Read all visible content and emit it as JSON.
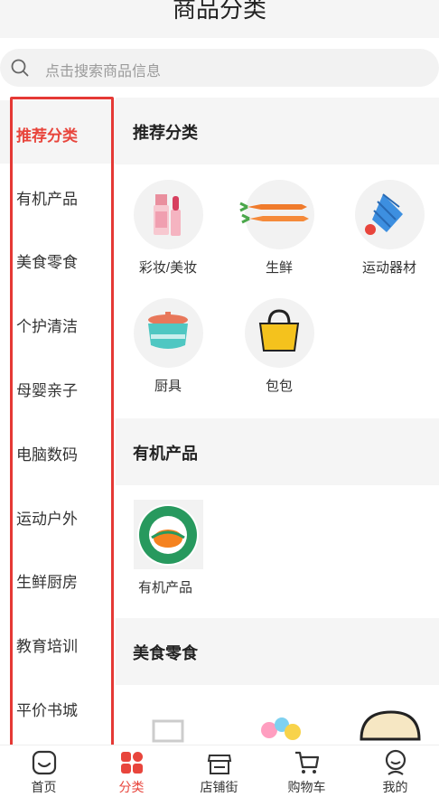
{
  "header": {
    "title": "商品分类"
  },
  "search": {
    "placeholder": "点击搜索商品信息"
  },
  "sidebar": {
    "items": [
      {
        "label": "推荐分类",
        "active": true
      },
      {
        "label": "有机产品"
      },
      {
        "label": "美食零食"
      },
      {
        "label": "个护清洁"
      },
      {
        "label": "母婴亲子"
      },
      {
        "label": "电脑数码"
      },
      {
        "label": "运动户外"
      },
      {
        "label": "生鲜厨房"
      },
      {
        "label": "教育培训"
      },
      {
        "label": "平价书城"
      }
    ]
  },
  "sections": [
    {
      "title": "推荐分类",
      "items": [
        {
          "label": "彩妆/美妆",
          "icon": "cosmetics-icon"
        },
        {
          "label": "生鲜",
          "icon": "carrot-icon"
        },
        {
          "label": "运动器材",
          "icon": "shuttlecock-icon"
        },
        {
          "label": "厨具",
          "icon": "pot-icon"
        },
        {
          "label": "包包",
          "icon": "bag-icon"
        }
      ]
    },
    {
      "title": "有机产品",
      "items": [
        {
          "label": "有机产品",
          "icon": "organic-logo-icon"
        }
      ]
    },
    {
      "title": "美食零食",
      "items": []
    }
  ],
  "tabbar": {
    "items": [
      {
        "label": "首页",
        "icon": "home-icon"
      },
      {
        "label": "分类",
        "icon": "category-icon",
        "active": true
      },
      {
        "label": "店铺街",
        "icon": "store-icon"
      },
      {
        "label": "购物车",
        "icon": "cart-icon"
      },
      {
        "label": "我的",
        "icon": "profile-icon"
      }
    ]
  },
  "colors": {
    "accent": "#e8453c",
    "highlight_box": "#e53935"
  }
}
